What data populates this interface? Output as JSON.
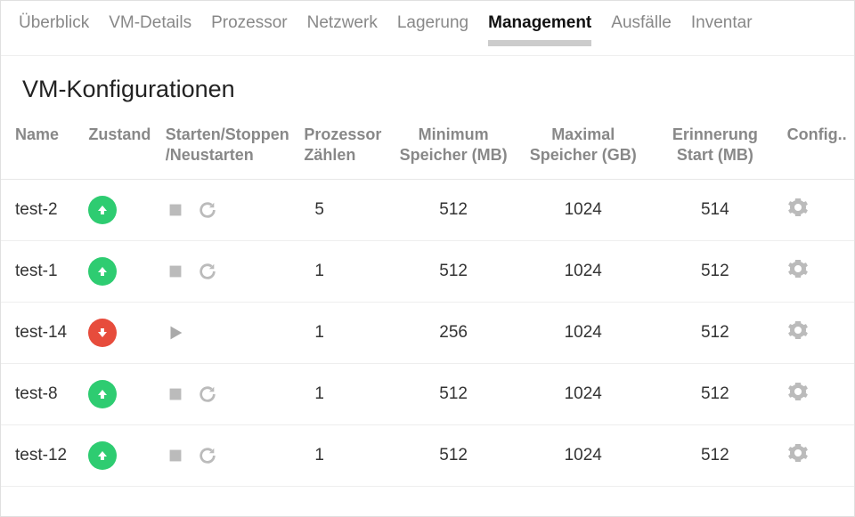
{
  "tabs": [
    {
      "label": "Überblick",
      "active": false
    },
    {
      "label": "VM-Details",
      "active": false
    },
    {
      "label": "Prozessor",
      "active": false
    },
    {
      "label": "Netzwerk",
      "active": false
    },
    {
      "label": "Lagerung",
      "active": false
    },
    {
      "label": "Management",
      "active": true
    },
    {
      "label": "Ausfälle",
      "active": false
    },
    {
      "label": "Inventar",
      "active": false
    }
  ],
  "page_title": "VM-Konfigurationen",
  "columns": {
    "name": "Name",
    "state": "Zustand",
    "actions": "Starten/Stoppen/Neustarten",
    "cpu": "Prozessor Zählen",
    "min_mem": "Minimum Speicher (MB)",
    "max_mem": "Maximal Speicher (GB)",
    "start_mem": "Erinnerung Start (MB)",
    "config": "Config.."
  },
  "rows": [
    {
      "name": "test-2",
      "state": "up",
      "cpu": "5",
      "min_mem": "512",
      "max_mem": "1024",
      "start_mem": "514"
    },
    {
      "name": "test-1",
      "state": "up",
      "cpu": "1",
      "min_mem": "512",
      "max_mem": "1024",
      "start_mem": "512"
    },
    {
      "name": "test-14",
      "state": "down",
      "cpu": "1",
      "min_mem": "256",
      "max_mem": "1024",
      "start_mem": "512"
    },
    {
      "name": "test-8",
      "state": "up",
      "cpu": "1",
      "min_mem": "512",
      "max_mem": "1024",
      "start_mem": "512"
    },
    {
      "name": "test-12",
      "state": "up",
      "cpu": "1",
      "min_mem": "512",
      "max_mem": "1024",
      "start_mem": "512"
    }
  ]
}
